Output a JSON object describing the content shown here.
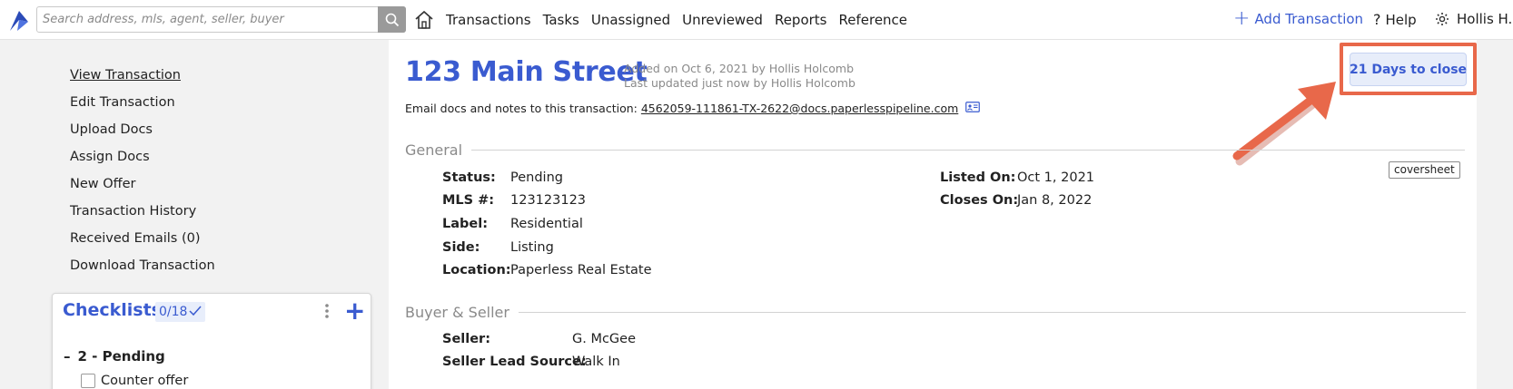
{
  "search": {
    "placeholder": "Search address, mls, agent, seller, buyer"
  },
  "nav": {
    "items": [
      "Transactions",
      "Tasks",
      "Unassigned",
      "Unreviewed",
      "Reports",
      "Reference"
    ]
  },
  "topright": {
    "add_transaction": "Add Transaction",
    "help": "Help",
    "user": "Hollis H."
  },
  "sidebar": {
    "links": [
      "View Transaction",
      "Edit Transaction",
      "Upload Docs",
      "Assign Docs",
      "New Offer",
      "Transaction History",
      "Received Emails (0)",
      "Download Transaction"
    ]
  },
  "checklists": {
    "title": "Checklists",
    "count": "0/18",
    "group": "2 - Pending",
    "item": "Counter offer"
  },
  "transaction": {
    "title": "123 Main Street",
    "added": "Added on Oct 6, 2021 by Hollis Holcomb",
    "updated": "Last updated just now by Hollis Holcomb",
    "email_prefix": "Email docs and notes to this transaction:",
    "email": "4562059-111861-TX-2622@docs.paperlesspipeline.com",
    "days_to_close": "21 Days to close",
    "coversheet": "coversheet"
  },
  "general": {
    "heading": "General",
    "left": [
      {
        "label": "Status:",
        "value": "Pending"
      },
      {
        "label": "MLS #:",
        "value": "123123123"
      },
      {
        "label": "Label:",
        "value": "Residential"
      },
      {
        "label": "Side:",
        "value": "Listing"
      },
      {
        "label": "Location:",
        "value": "Paperless Real Estate"
      }
    ],
    "right": [
      {
        "label": "Listed On:",
        "value": "Oct 1, 2021"
      },
      {
        "label": "Closes On:",
        "value": "Jan 8, 2022"
      }
    ]
  },
  "buyer_seller": {
    "heading": "Buyer & Seller",
    "fields": [
      {
        "label": "Seller:",
        "value": "G. McGee"
      },
      {
        "label": "Seller Lead Source:",
        "value": "Walk In"
      }
    ]
  },
  "colors": {
    "accent": "#3a5bd0",
    "highlight": "#e8684a",
    "sidebar_bg": "#f2f2f2"
  }
}
